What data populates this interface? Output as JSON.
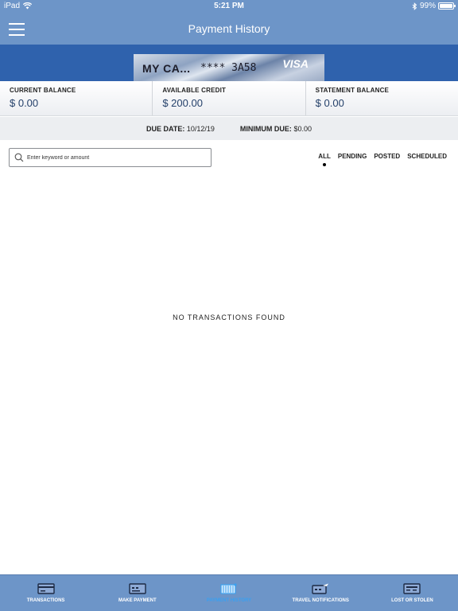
{
  "status_bar": {
    "device": "iPad",
    "time": "5:21 PM",
    "battery": "99%"
  },
  "header": {
    "title": "Payment History"
  },
  "card": {
    "name": "MY CA...",
    "number": "**** 3A58",
    "brand": "VISA"
  },
  "balances": [
    {
      "label": "CURRENT BALANCE",
      "value": "$ 0.00"
    },
    {
      "label": "AVAILABLE CREDIT",
      "value": "$ 200.00"
    },
    {
      "label": "STATEMENT BALANCE",
      "value": "$ 0.00"
    }
  ],
  "due": {
    "due_label": "DUE DATE:",
    "due_value": "10/12/19",
    "min_label": "MINIMUM DUE:",
    "min_value": "$0.00"
  },
  "search": {
    "placeholder": "Enter keyword or amount"
  },
  "filters": [
    {
      "label": "ALL",
      "selected": true
    },
    {
      "label": "PENDING",
      "selected": false
    },
    {
      "label": "POSTED",
      "selected": false
    },
    {
      "label": "SCHEDULED",
      "selected": false
    }
  ],
  "empty_message": "NO TRANSACTIONS FOUND",
  "tabbar": [
    {
      "label": "TRANSACTIONS",
      "icon": "card-icon",
      "active": false
    },
    {
      "label": "MAKE PAYMENT",
      "icon": "card-payment-icon",
      "active": false
    },
    {
      "label": "PAYMENT HISTORY",
      "icon": "calendar-icon",
      "active": true
    },
    {
      "label": "TRAVEL NOTIFICATIONS",
      "icon": "card-plane-icon",
      "active": false
    },
    {
      "label": "LOST OR STOLEN",
      "icon": "card-lock-icon",
      "active": false
    }
  ],
  "colors": {
    "header": "#6d95c8",
    "card_band": "#2f62ad",
    "active_tab": "#3aa0f0",
    "balance_value": "#24406a"
  }
}
